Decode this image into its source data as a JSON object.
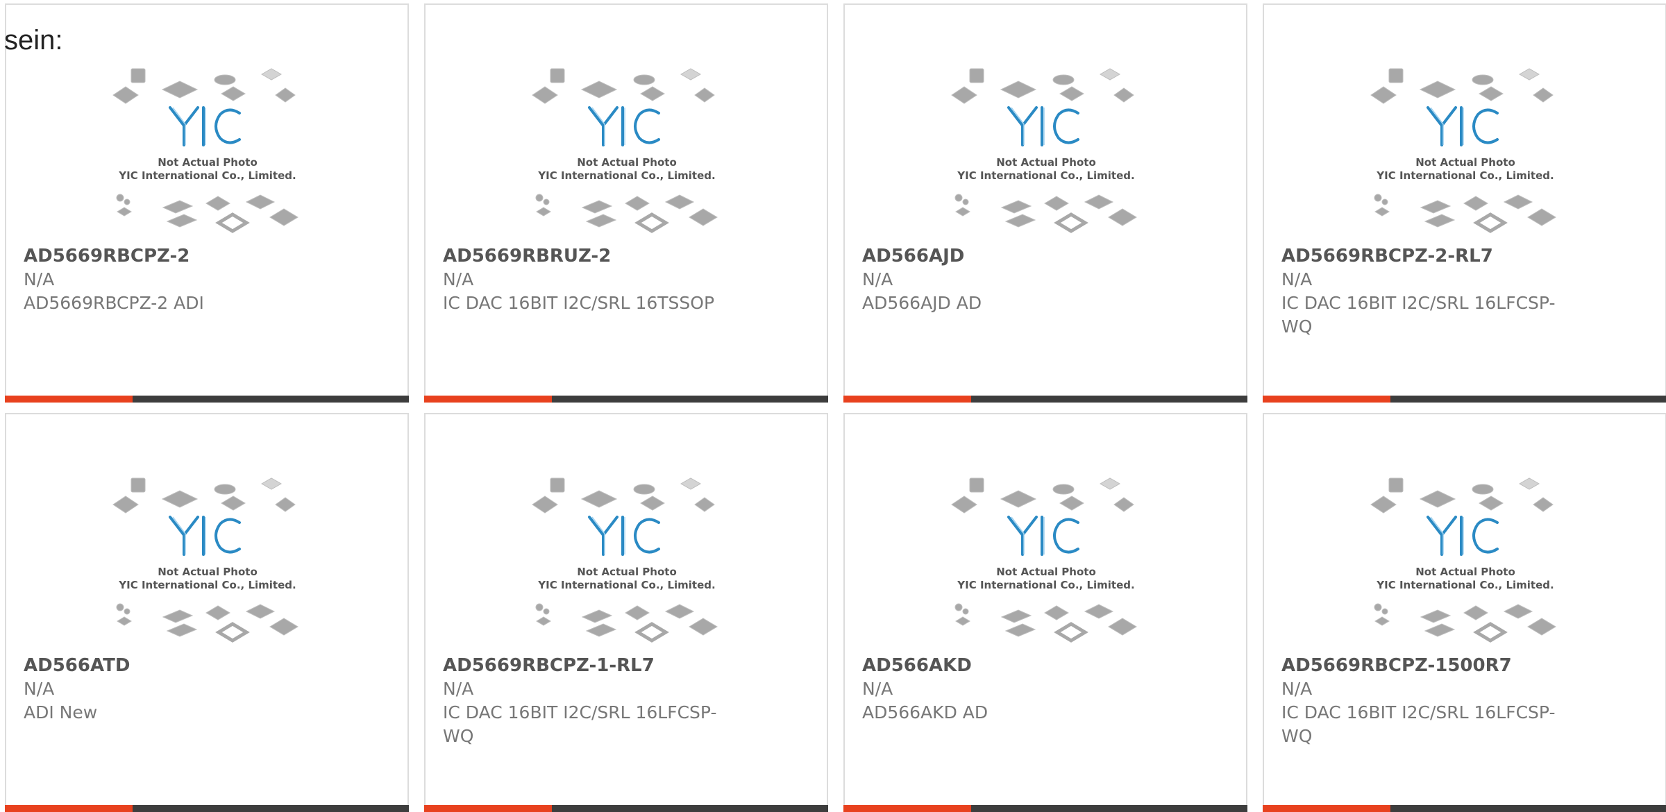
{
  "lead_text": "sein:",
  "colors": {
    "accent": "#e8411e",
    "bar": "#3d3d3d",
    "border": "#dcdcdc",
    "logo": "#2a8ac4"
  },
  "placeholder": {
    "line1": "Not Actual Photo",
    "line2": "YIC International Co., Limited.",
    "logo": "YIC"
  },
  "products": [
    {
      "part": "AD5669RBCPZ-2",
      "stock": "N/A",
      "desc": "AD5669RBCPZ-2 ADI"
    },
    {
      "part": "AD5669RBRUZ-2",
      "stock": "N/A",
      "desc": "IC DAC 16BIT I2C/SRL 16TSSOP"
    },
    {
      "part": "AD566AJD",
      "stock": "N/A",
      "desc": "AD566AJD AD"
    },
    {
      "part": "AD5669RBCPZ-2-RL7",
      "stock": "N/A",
      "desc": "IC DAC 16BIT I2C/SRL 16LFCSP-WQ"
    },
    {
      "part": "AD566ATD",
      "stock": "N/A",
      "desc": "ADI New"
    },
    {
      "part": "AD5669RBCPZ-1-RL7",
      "stock": "N/A",
      "desc": "IC DAC 16BIT I2C/SRL 16LFCSP-WQ"
    },
    {
      "part": "AD566AKD",
      "stock": "N/A",
      "desc": "AD566AKD AD"
    },
    {
      "part": "AD5669RBCPZ-1500R7",
      "stock": "N/A",
      "desc": "IC DAC 16BIT I2C/SRL 16LFCSP-WQ"
    }
  ]
}
